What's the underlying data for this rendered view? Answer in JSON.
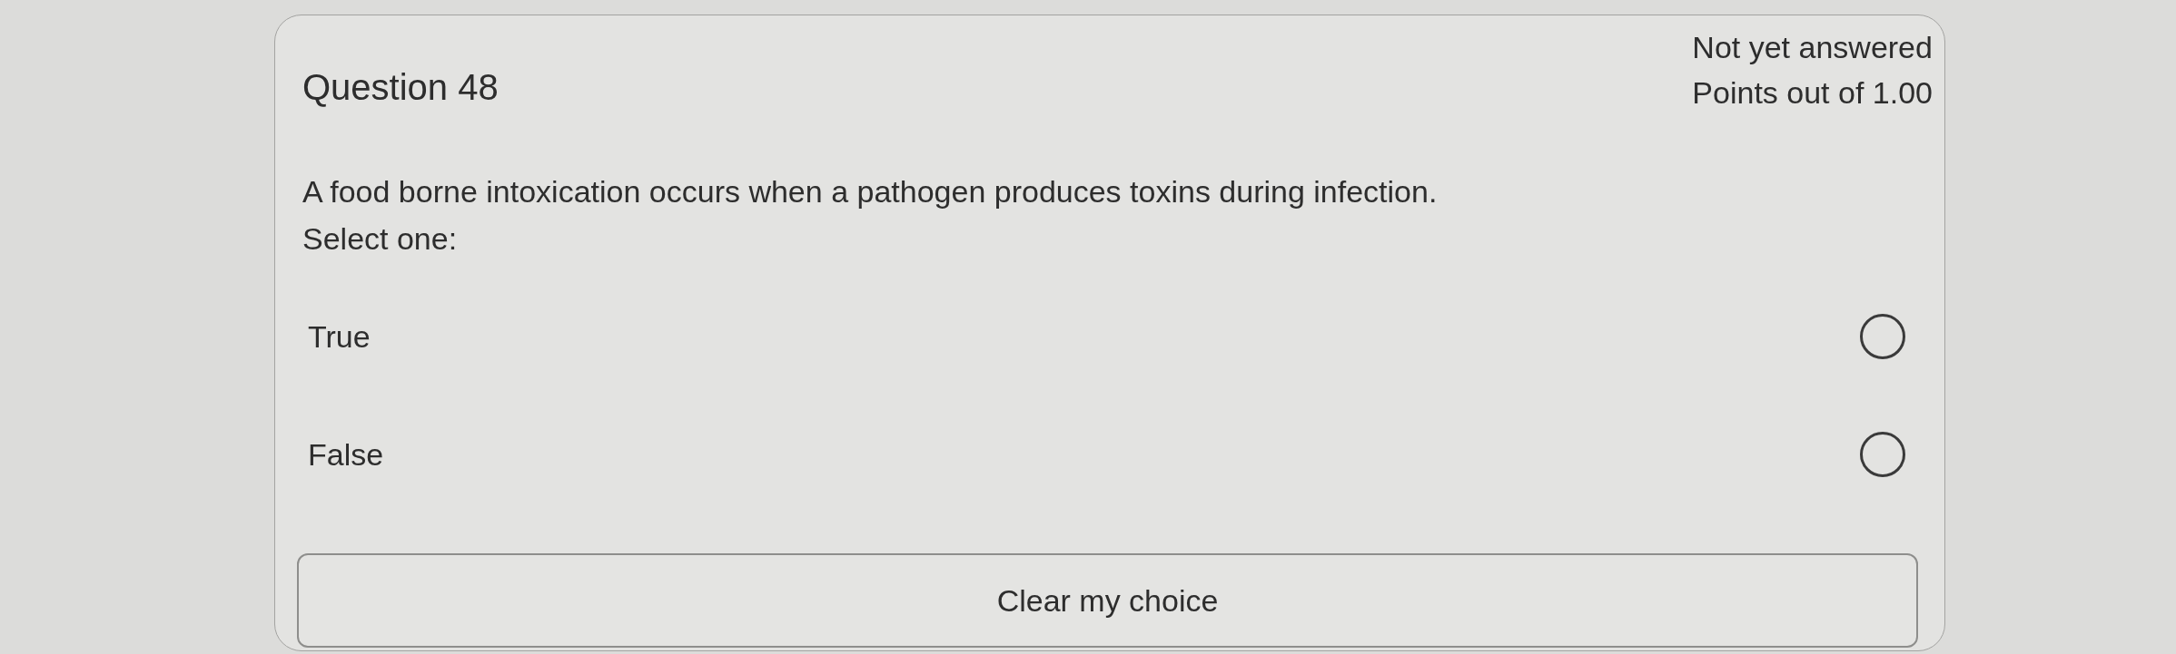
{
  "question": {
    "title": "Question 48",
    "status": "Not yet answered",
    "points": "Points out of 1.00",
    "text": "A food borne intoxication occurs when a pathogen produces toxins during infection.",
    "prompt": "Select one:"
  },
  "options": [
    {
      "label": "True",
      "selected": false
    },
    {
      "label": "False",
      "selected": false
    }
  ],
  "clear_button": {
    "label": "Clear my choice"
  }
}
